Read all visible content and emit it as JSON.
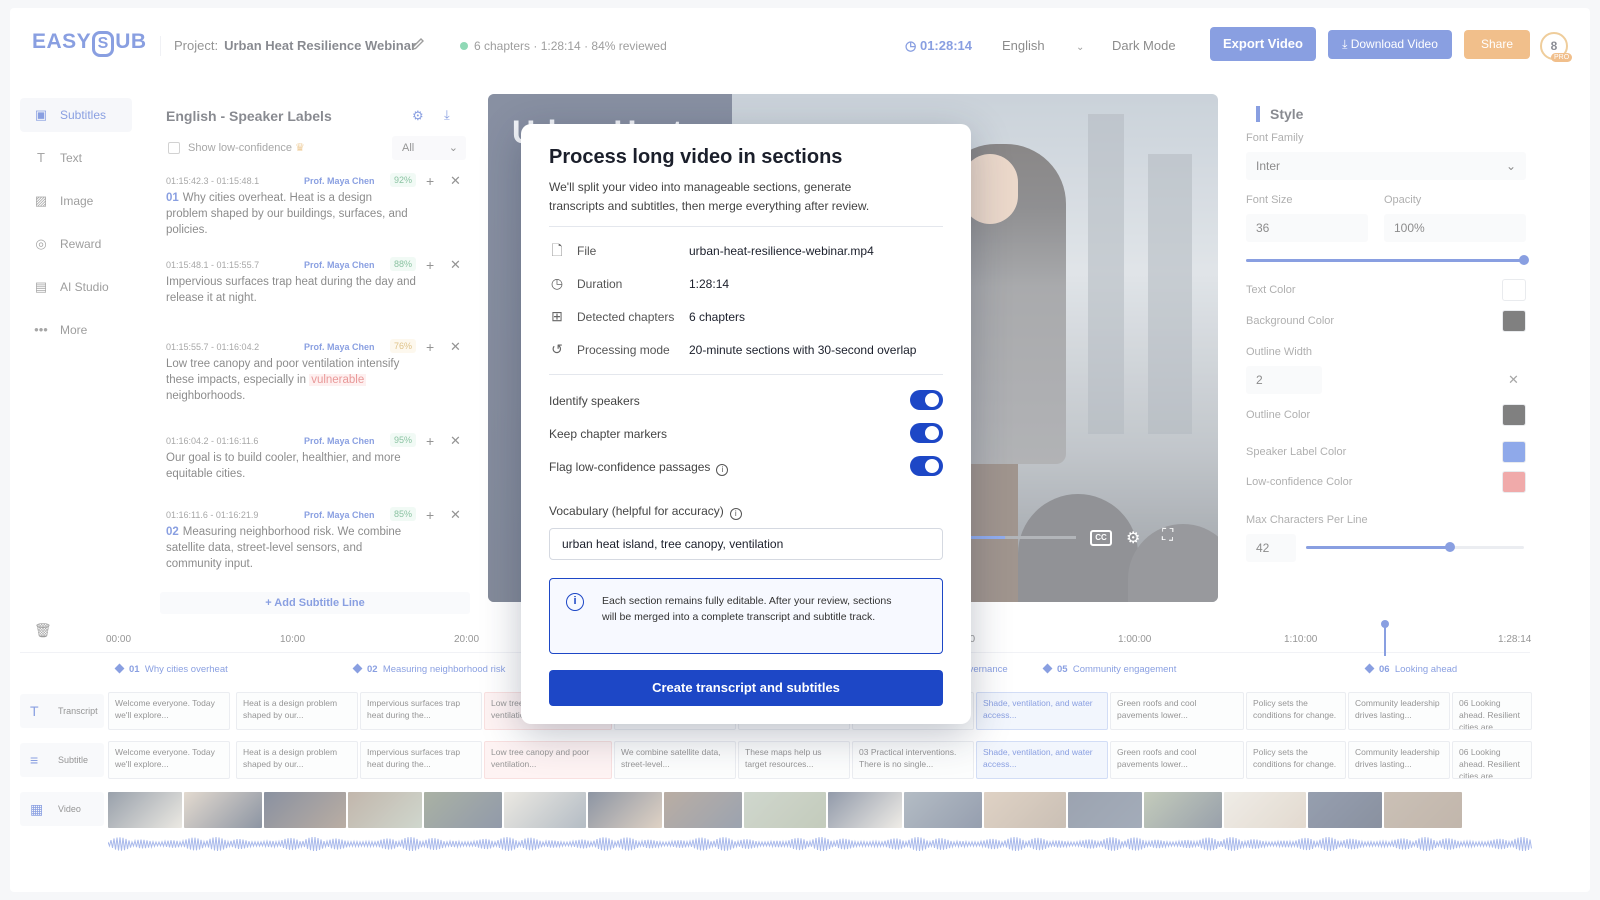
{
  "header": {
    "logo": "EASYSUB",
    "project_label": "Project:",
    "project_name": "Urban Heat Resilience Webinar",
    "stats": "6 chapters  ·  1:28:14  ·  84%  reviewed",
    "timecode": "01:28:14",
    "language": "English",
    "dark_mode": "Dark Mode",
    "export": "Export Video",
    "download": "Download Video",
    "share": "Share",
    "avatar_initial": "8",
    "pro_badge": "PRO"
  },
  "nav": [
    {
      "label": "Subtitles",
      "icon": "subtitles-icon"
    },
    {
      "label": "Text",
      "icon": "text-icon"
    },
    {
      "label": "Image",
      "icon": "image-icon"
    },
    {
      "label": "Reward",
      "icon": "reward-icon"
    },
    {
      "label": "AI Studio",
      "icon": "ai-studio-icon"
    },
    {
      "label": "More",
      "icon": "more-icon"
    }
  ],
  "subtitles_panel": {
    "title": "English - Speaker Labels",
    "show_low_confidence": "Show low-confidence",
    "filter": "All",
    "add_line": "+ Add Subtitle Line",
    "items": [
      {
        "time": "01:15:42.3 - 01:15:48.1",
        "speaker": "Prof. Maya Chen",
        "conf": "92%",
        "num": "01",
        "text": "Why cities overheat. Heat is a design problem shaped by our buildings, surfaces, and policies."
      },
      {
        "time": "01:15:48.1 - 01:15:55.7",
        "speaker": "Prof. Maya Chen",
        "conf": "88%",
        "num": "",
        "text": "Impervious surfaces trap heat during the day and release it at night."
      },
      {
        "time": "01:15:55.7 - 01:16:04.2",
        "speaker": "Prof. Maya Chen",
        "conf": "76%",
        "num": "",
        "text": "Low tree canopy and poor ventilation intensify these impacts, especially in",
        "highlight": "vulnerable",
        "text_after": "neighborhoods."
      },
      {
        "time": "01:16:04.2 - 01:16:11.6",
        "speaker": "Prof. Maya Chen",
        "conf": "95%",
        "num": "",
        "text": "Our goal is to build cooler, healthier, and more equitable cities."
      },
      {
        "time": "01:16:11.6 - 01:16:21.9",
        "speaker": "Prof. Maya Chen",
        "conf": "85%",
        "num": "02",
        "text": "Measuring neighborhood risk. We combine satellite data, street-level sensors, and community input."
      }
    ]
  },
  "video": {
    "slide_title": "Urban Heat"
  },
  "style_panel": {
    "title": "Style",
    "font_family_label": "Font Family",
    "font_family": "Inter",
    "font_size_label": "Font Size",
    "font_size": "36",
    "opacity_label": "Opacity",
    "opacity": "100%",
    "opacity_level": 1.0,
    "text_color_label": "Text Color",
    "background_color_label": "Background Color",
    "outline_width_label": "Outline Width",
    "outline_width": "2",
    "outline_color_label": "Outline Color",
    "speaker_label_color_label": "Speaker Label Color",
    "low_confidence_color_label": "Low-confidence Color",
    "max_chars_label": "Max Characters Per Line",
    "max_chars": "42",
    "max_chars_level": 0.66,
    "colors": {
      "text": "#ffffff",
      "background": "#0d0d0d",
      "outline": "#0d0d0d",
      "speaker_label": "#2a5bd7",
      "low_confidence": "#e25c5c"
    }
  },
  "timeline": {
    "ticks": [
      "00:00",
      "10:00",
      "20:00",
      "50:00",
      "1:00:00",
      "1:10:00",
      "1:28:14"
    ],
    "chapters": [
      {
        "num": "01",
        "title": "Why cities overheat"
      },
      {
        "num": "02",
        "title": "Measuring neighborhood risk"
      },
      {
        "num": "",
        "title": "governance"
      },
      {
        "num": "05",
        "title": "Community engagement"
      },
      {
        "num": "06",
        "title": "Looking ahead"
      }
    ],
    "tracks": {
      "transcript": "Transcript",
      "subtitle": "Subtitle",
      "video": "Video"
    },
    "transcript_clips": [
      "Welcome everyone. Today we'll explore...",
      "Heat is a design problem shaped by our...",
      "Impervious surfaces trap heat during the...",
      "Low tree canopy and poor ventilation...",
      "data, street-level...",
      "target resources...",
      "There is no single...",
      "Shade, ventilation, and water access...",
      "Green roofs and cool pavements lower...",
      "Policy sets the conditions for change.",
      "Community leadership drives lasting...",
      "06 Looking ahead. Resilient cities are..."
    ],
    "subtitle_clips": [
      "Welcome everyone. Today we'll explore...",
      "Heat is a design problem shaped by our...",
      "Impervious surfaces trap heat during the...",
      "Low tree canopy and poor ventilation...",
      "We combine satellite data, street-level...",
      "These maps help us target resources...",
      "03 Practical interventions. There is no single...",
      "Shade, ventilation, and water access...",
      "Green roofs and cool pavements lower...",
      "Policy sets the conditions for change.",
      "Community leadership drives lasting...",
      "06 Looking ahead. Resilient cities are..."
    ]
  },
  "modal": {
    "title": "Process long video in sections",
    "description": "We'll split your video into manageable sections, generate transcripts and subtitles, then merge everything after review.",
    "rows": [
      {
        "key": "File",
        "value": "urban-heat-resilience-webinar.mp4",
        "icon": "file-icon"
      },
      {
        "key": "Duration",
        "value": "1:28:14",
        "icon": "clock-icon"
      },
      {
        "key": "Detected chapters",
        "value": "6 chapters",
        "icon": "chapters-icon"
      },
      {
        "key": "Processing mode",
        "value": "20-minute sections with 30-second overlap",
        "icon": "history-icon"
      }
    ],
    "toggles": [
      {
        "label": "Identify speakers",
        "on": true
      },
      {
        "label": "Keep chapter markers",
        "on": true
      },
      {
        "label": "Flag low-confidence passages",
        "on": true
      }
    ],
    "vocab_label": "Vocabulary  (helpful for accuracy)",
    "vocab_value": "urban heat island, tree canopy, ventilation",
    "notice": "Each section remains fully editable. After your review, sections will be merged into a complete transcript and subtitle track.",
    "cta": "Create transcript and subtitles"
  }
}
